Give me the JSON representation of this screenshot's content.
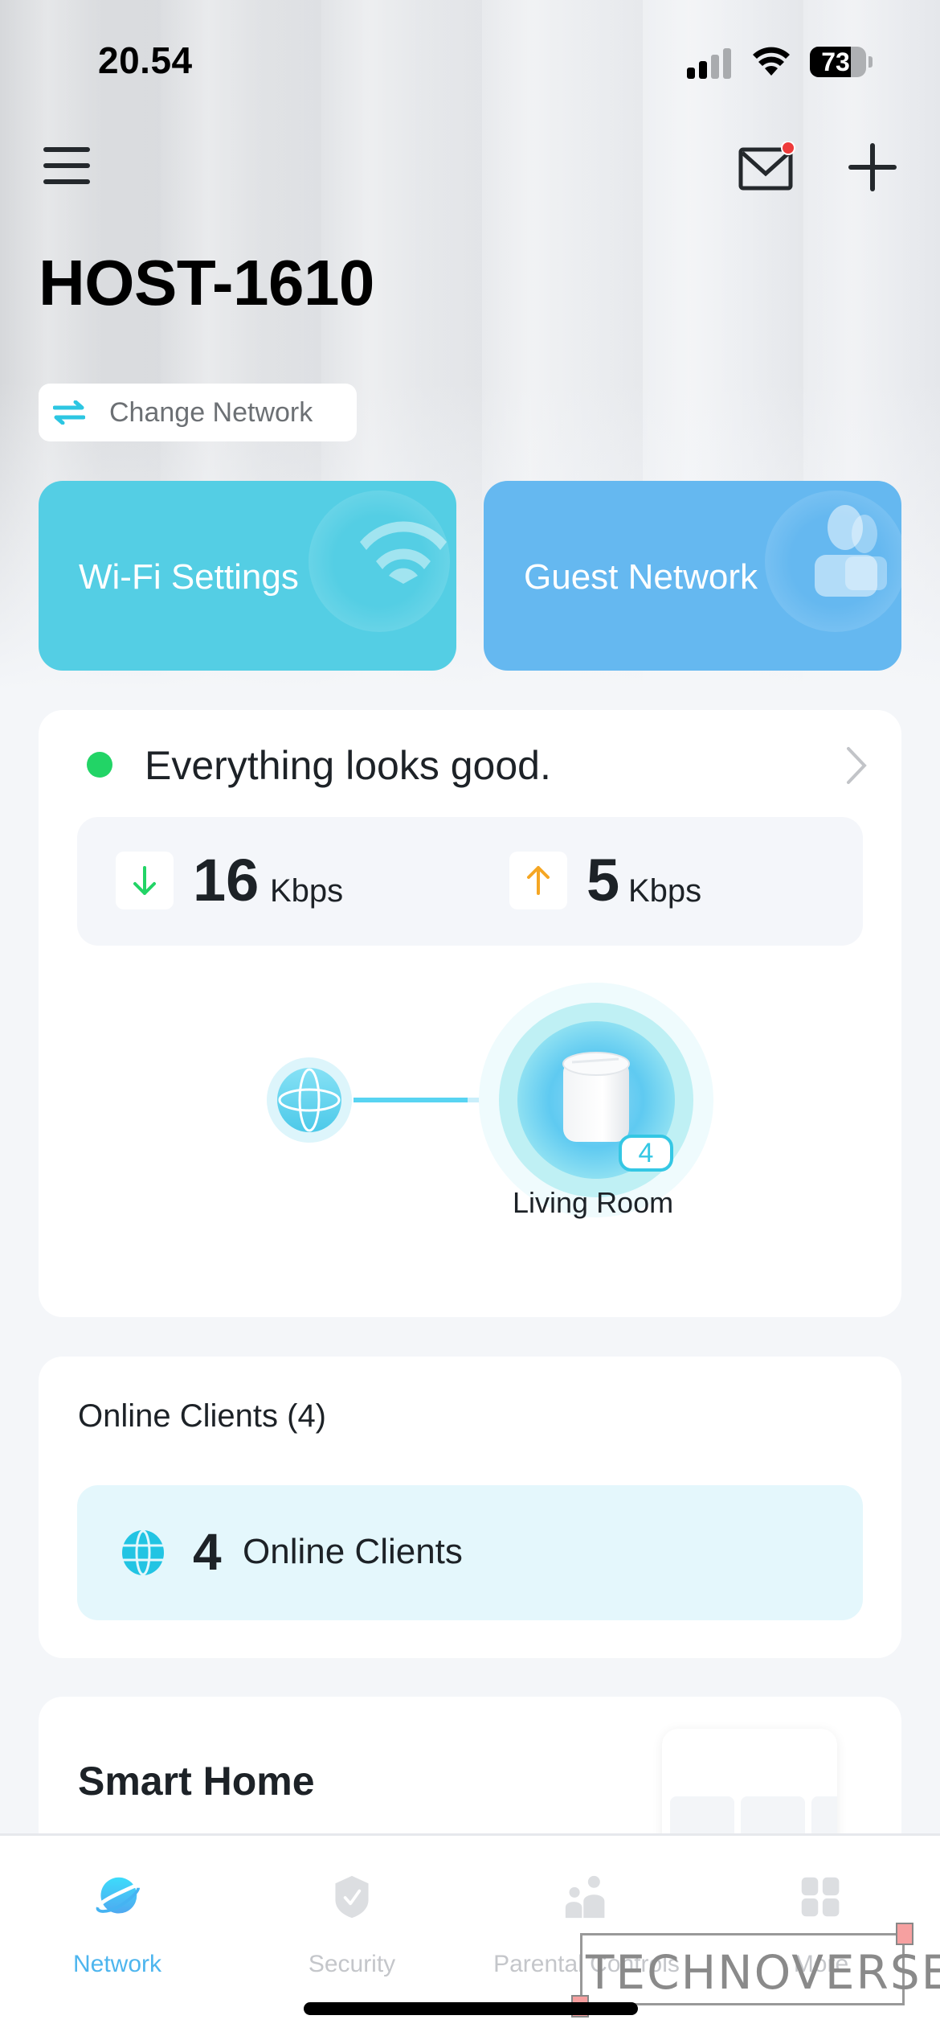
{
  "status_bar": {
    "time": "20.54",
    "signal_bars_filled": 2,
    "signal_bars_total": 4,
    "battery_percent": "73"
  },
  "header": {
    "menu_icon": "hamburger-menu-icon",
    "mail_icon": "mail-icon",
    "mail_has_notification": true,
    "add_icon": "plus-icon"
  },
  "network_name": "HOST-1610",
  "change_network": {
    "label": "Change Network",
    "icon": "swap-arrows-icon"
  },
  "quick_actions": [
    {
      "label": "Wi-Fi Settings",
      "icon": "wifi-icon",
      "color": "#54CEE4"
    },
    {
      "label": "Guest Network",
      "icon": "guests-icon",
      "color": "#65B8F0"
    }
  ],
  "status": {
    "text": "Everything looks good.",
    "indicator_color": "#22D466",
    "download": {
      "value": "16",
      "unit": "Kbps",
      "arrow_color": "#22D466"
    },
    "upload": {
      "value": "5",
      "unit": "Kbps",
      "arrow_color": "#F5A623"
    }
  },
  "topology": {
    "internet_node": "internet-globe-icon",
    "devices": [
      {
        "name": "Living Room",
        "clients": "4"
      }
    ]
  },
  "online_clients": {
    "title": "Online Clients (4)",
    "count": "4",
    "label": "Online Clients"
  },
  "smart_home": {
    "title": "Smart Home"
  },
  "tabbar": {
    "tabs": [
      {
        "label": "Network",
        "active": true
      },
      {
        "label": "Security",
        "active": false
      },
      {
        "label": "Parental Controls",
        "active": false
      },
      {
        "label": "More",
        "active": false
      }
    ]
  },
  "watermark": "TECHNOVERSE",
  "colors": {
    "accent": "#4DB5EE",
    "teal": "#34C7E4",
    "background": "#F4F6F9"
  }
}
